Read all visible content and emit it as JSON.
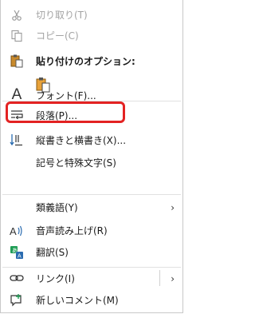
{
  "menu": {
    "cut": {
      "label": "切り取り(T)",
      "icon": "scissors-icon"
    },
    "copy": {
      "label": "コピー(C)",
      "icon": "copy-icon"
    },
    "paste_options": {
      "label": "貼り付けのオプション:",
      "icon": "clipboard-icon"
    },
    "paste_keep_format": {
      "icon": "paste-keep-formatting-icon"
    },
    "font": {
      "label": "フォント(F)...",
      "icon": "font-icon"
    },
    "paragraph": {
      "label": "段落(P)...",
      "icon": "paragraph-icon"
    },
    "text_direction": {
      "label": "縦書きと横書き(X)...",
      "icon": "text-direction-icon"
    },
    "symbols": {
      "label": "記号と特殊文字(S)"
    },
    "thesaurus": {
      "label": "類義語(Y)",
      "arrow": "›"
    },
    "read_aloud": {
      "label": "音声読み上げ(R)",
      "icon": "read-aloud-icon"
    },
    "translate": {
      "label": "翻訳(S)",
      "icon": "translate-icon"
    },
    "link": {
      "label": "リンク(I)",
      "arrow": "›",
      "icon": "link-icon"
    },
    "new_comment": {
      "label": "新しいコメント(M)",
      "icon": "new-comment-icon"
    }
  },
  "colors": {
    "highlight_border": "#e32222",
    "disabled_text": "#a3a3a3",
    "accent_blue": "#2b6cb0",
    "translate_green": "#1f9d55"
  }
}
